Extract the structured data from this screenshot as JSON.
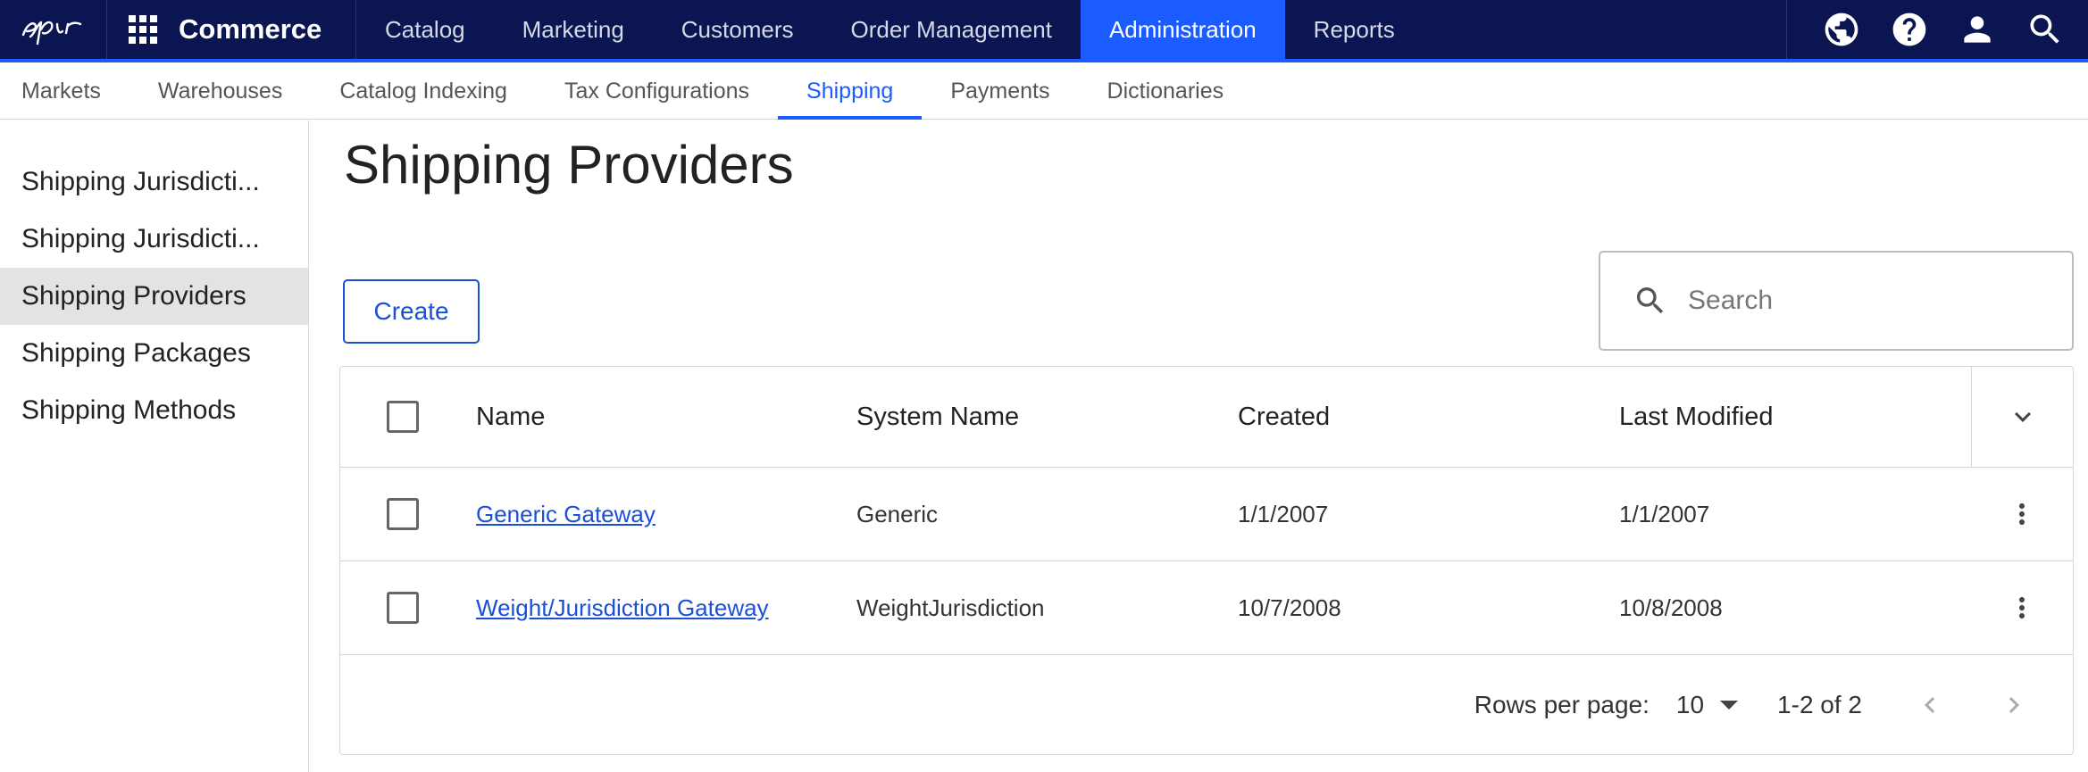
{
  "topbar": {
    "brand": "Commerce",
    "nav": [
      "Catalog",
      "Marketing",
      "Customers",
      "Order Management",
      "Administration",
      "Reports"
    ],
    "active_nav": "Administration",
    "icons": [
      "globe-icon",
      "help-icon",
      "user-icon",
      "search-icon"
    ]
  },
  "subnav": {
    "items": [
      "Markets",
      "Warehouses",
      "Catalog Indexing",
      "Tax Configurations",
      "Shipping",
      "Payments",
      "Dictionaries"
    ],
    "active": "Shipping"
  },
  "sidebar": {
    "items": [
      "Shipping Jurisdicti...",
      "Shipping Jurisdicti...",
      "Shipping Providers",
      "Shipping Packages",
      "Shipping Methods"
    ],
    "active": "Shipping Providers"
  },
  "main": {
    "title": "Shipping Providers",
    "create_label": "Create",
    "search_placeholder": "Search"
  },
  "table": {
    "columns": [
      "Name",
      "System Name",
      "Created",
      "Last Modified"
    ],
    "rows": [
      {
        "name": "Generic Gateway",
        "system_name": "Generic",
        "created": "1/1/2007",
        "modified": "1/1/2007"
      },
      {
        "name": "Weight/Jurisdiction Gateway",
        "system_name": "WeightJurisdiction",
        "created": "10/7/2008",
        "modified": "10/8/2008"
      }
    ]
  },
  "pagination": {
    "rows_label": "Rows per page:",
    "rows_value": "10",
    "range": "1-2 of 2"
  },
  "colors": {
    "topbar": "#0b1551",
    "accent": "#1a5cff",
    "link": "#1a4fd6"
  }
}
